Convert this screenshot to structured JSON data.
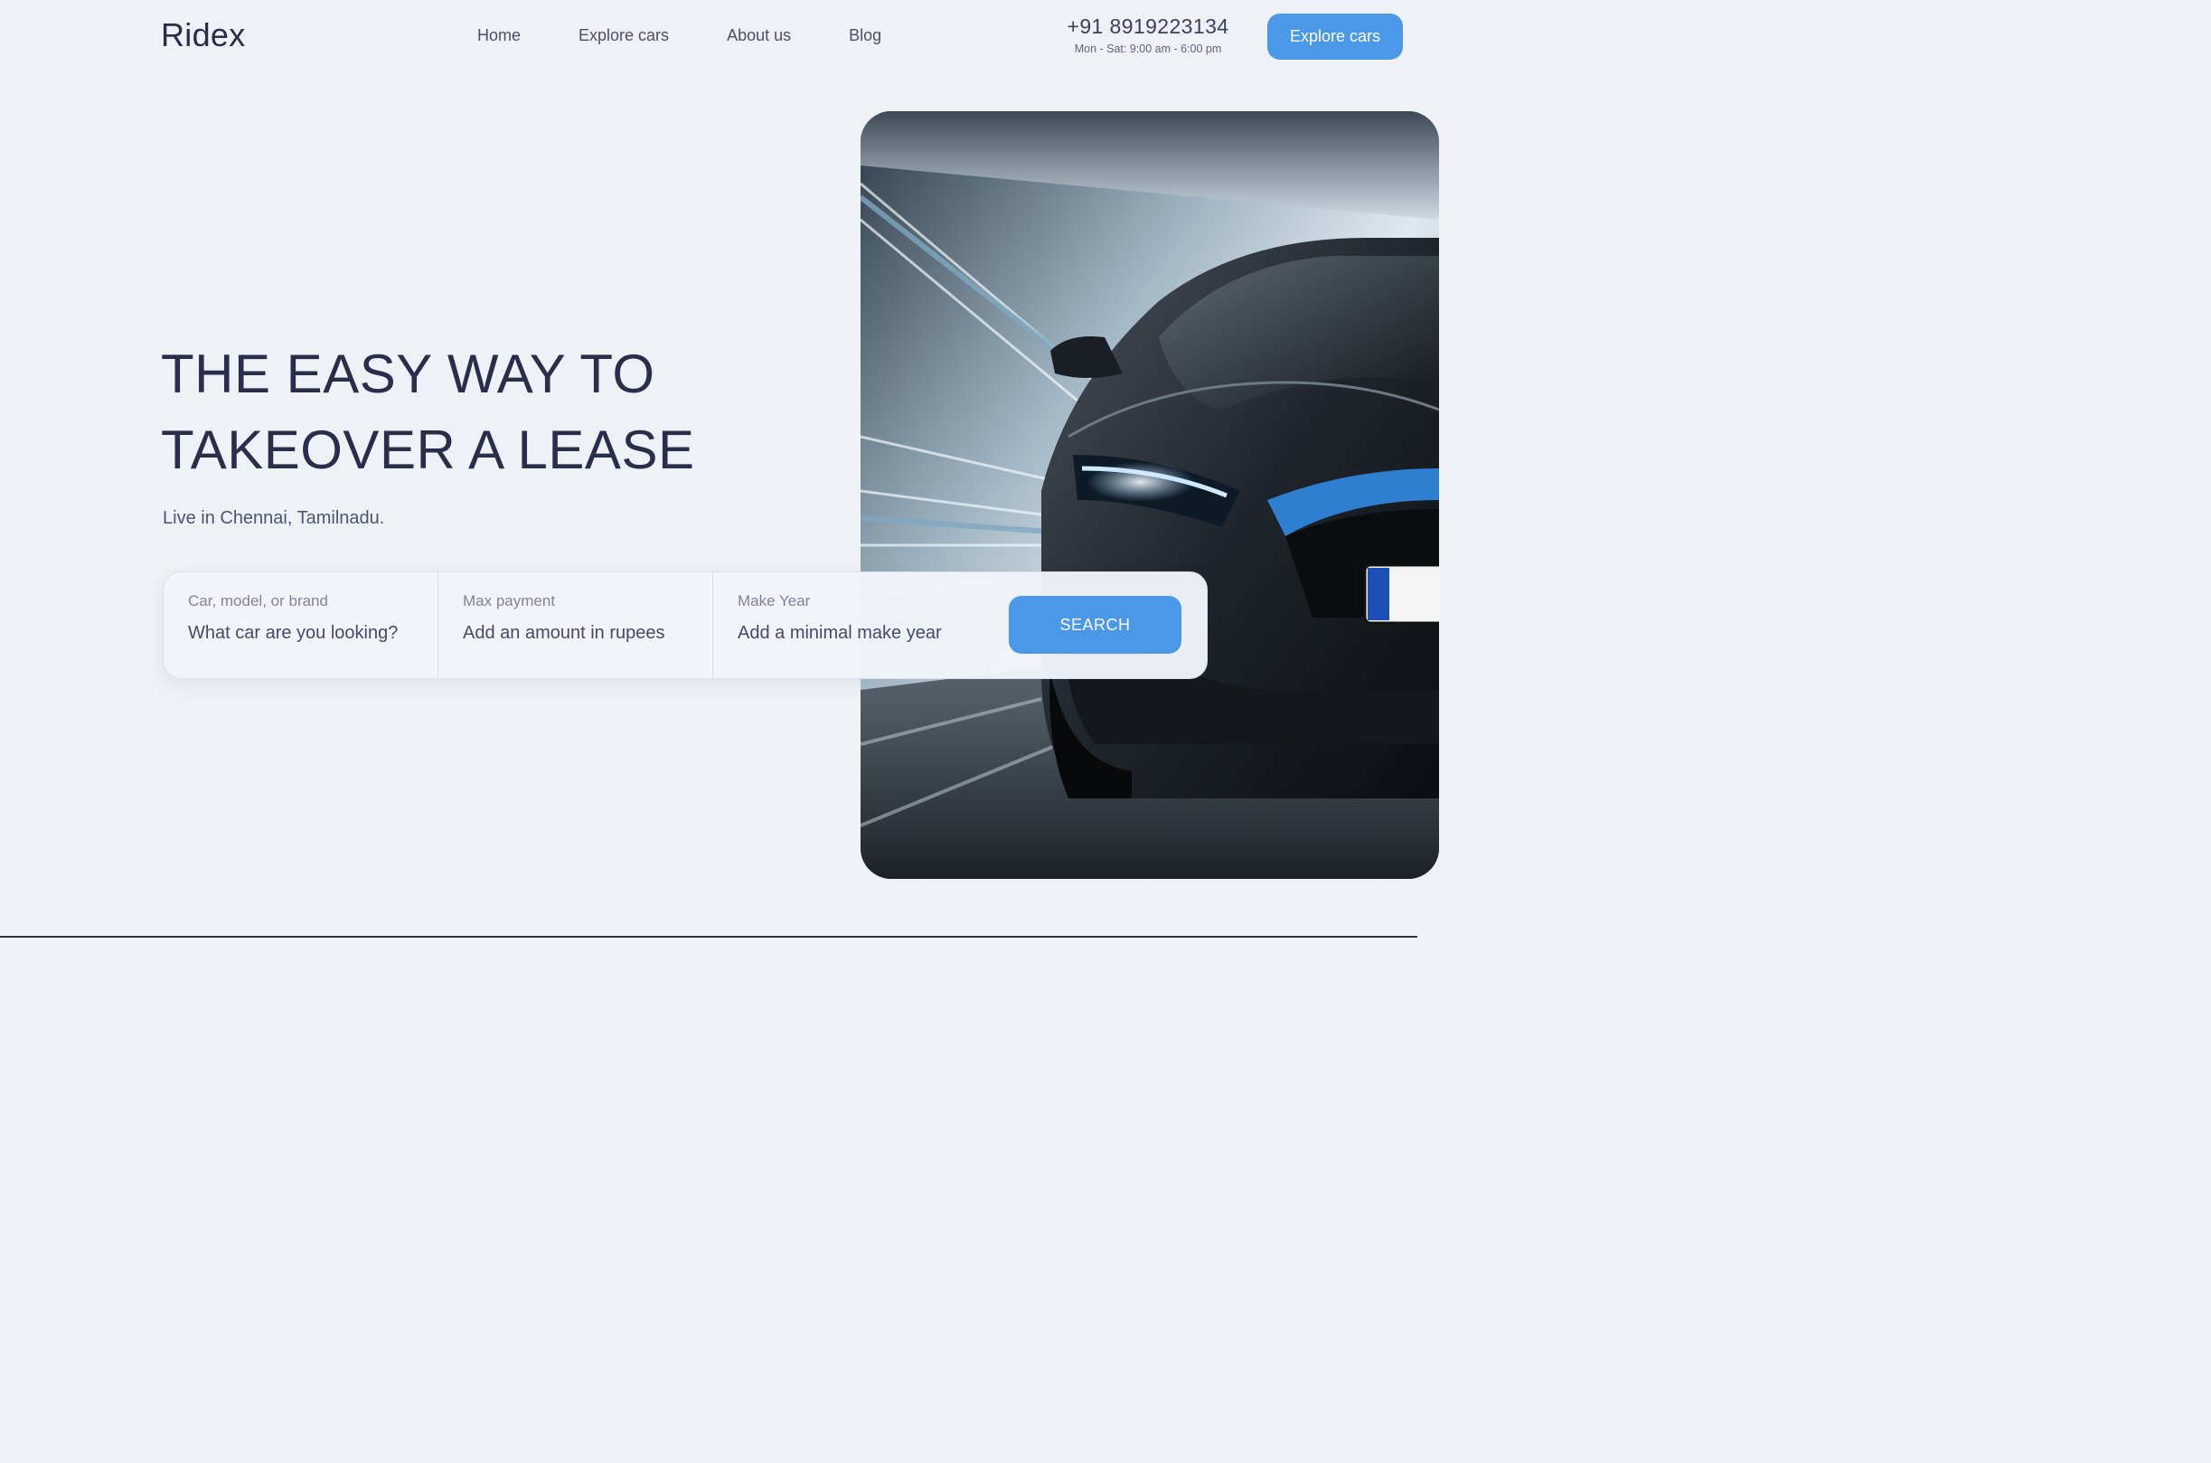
{
  "brand": {
    "logo": "Ridex"
  },
  "nav": {
    "items": [
      "Home",
      "Explore cars",
      "About us",
      "Blog"
    ]
  },
  "contact": {
    "phone": "+91 8919223134",
    "hours": "Mon - Sat: 9:00 am - 6:00 pm"
  },
  "header": {
    "cta_label": "Explore cars"
  },
  "hero": {
    "title_line1": "THE EASY WAY TO",
    "title_line2": "TAKEOVER A LEASE",
    "subtitle": "Live in Chennai, Tamilnadu.",
    "image": "sports-car-photo"
  },
  "search": {
    "fields": [
      {
        "label": "Car, model, or brand",
        "placeholder": "What car are you looking?"
      },
      {
        "label": "Max payment",
        "placeholder": "Add an amount in rupees"
      },
      {
        "label": "Make Year",
        "placeholder": "Add a minimal make year"
      }
    ],
    "button_label": "SEARCH"
  },
  "colors": {
    "background": "#eef2f7",
    "accent": "#4a98e7",
    "text_dark": "#2b2e4b"
  }
}
